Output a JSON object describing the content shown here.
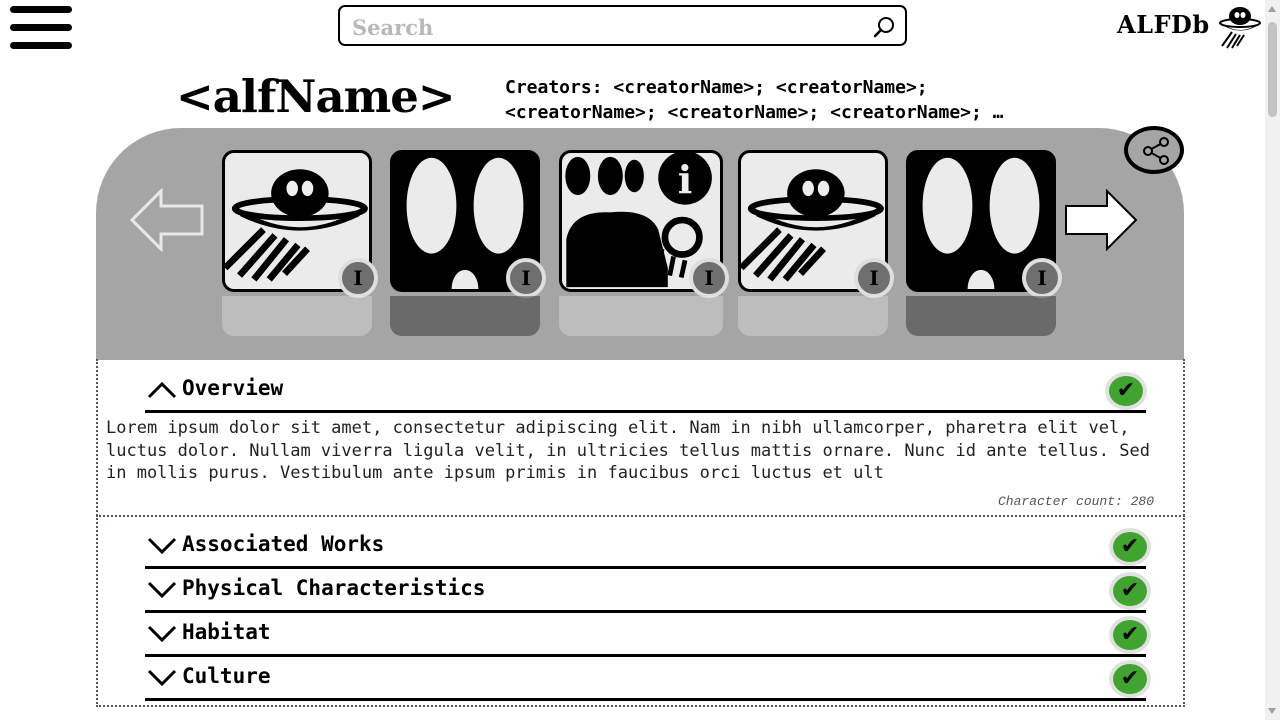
{
  "header": {
    "search_placeholder": "Search",
    "logo_text": "ALFDb",
    "menu_icon": "hamburger-menu-icon",
    "search_icon": "search-icon",
    "logo_icon": "ufo-logo-icon"
  },
  "alf": {
    "name": "<alfName>",
    "creators_line1": "Creators: <creatorName>; <creatorName>;",
    "creators_line2": "<creatorName>; <creatorName>; <creatorName>; …"
  },
  "carousel": {
    "left_arrow_icon": "arrow-left-icon",
    "right_arrow_icon": "arrow-right-icon",
    "share_icon": "share-icon",
    "items": [
      {
        "image": "ufo-image",
        "info_label": "I"
      },
      {
        "image": "alien-face-image",
        "info_label": "I"
      },
      {
        "image": "aliens-info-image",
        "info_label": "I"
      },
      {
        "image": "ufo-image",
        "info_label": "I"
      },
      {
        "image": "alien-face-image",
        "info_label": "I"
      }
    ]
  },
  "sections": [
    {
      "title": "Overview",
      "expanded": true,
      "status_icon": "checkmark-icon",
      "status_glyph": "✔"
    },
    {
      "title": "Associated Works",
      "expanded": false,
      "status_icon": "checkmark-icon",
      "status_glyph": "✔"
    },
    {
      "title": "Physical Characteristics",
      "expanded": false,
      "status_icon": "checkmark-icon",
      "status_glyph": "✔"
    },
    {
      "title": "Habitat",
      "expanded": false,
      "status_icon": "checkmark-icon",
      "status_glyph": "✔"
    },
    {
      "title": "Culture",
      "expanded": false,
      "status_icon": "checkmark-icon",
      "status_glyph": "✔"
    }
  ],
  "overview": {
    "text": "Lorem ipsum dolor sit amet, consectetur adipiscing elit. Nam in nibh ullamcorper, pharetra elit vel, luctus dolor. Nullam viverra ligula velit, in ultricies tellus mattis ornare. Nunc id ante tellus. Sed in mollis purus. Vestibulum ante ipsum primis in faucibus orci luctus et ult",
    "char_count": "Character count: 280"
  },
  "colors": {
    "carousel_bg": "#a5a5a5",
    "check_green": "#3fa52f",
    "info_badge": "#6f6f6f"
  }
}
